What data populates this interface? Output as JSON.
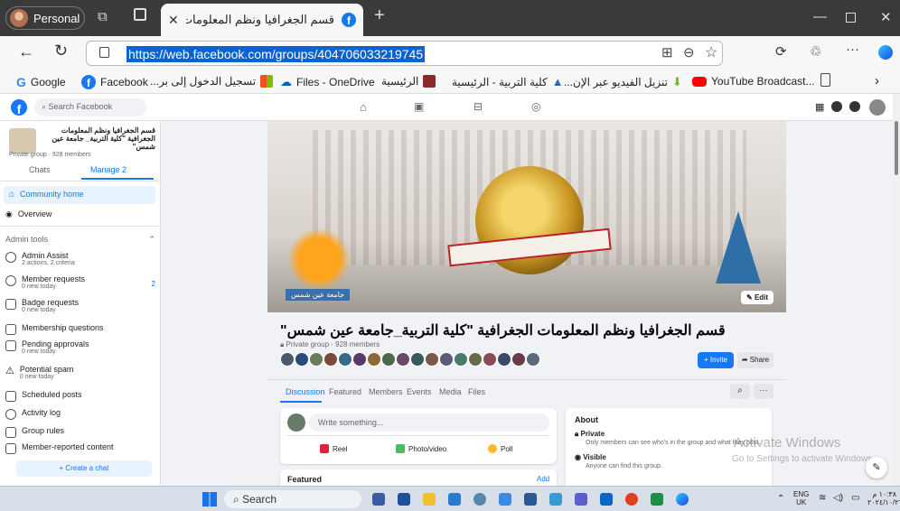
{
  "browser": {
    "profile_label": "Personal",
    "tab_title": "قسم الجغرافيا ونظم المعلومات الجغ",
    "new_tab": "+",
    "url": "https://web.facebook.com/groups/404706033219745"
  },
  "bookmarks": [
    {
      "label": "Google",
      "color": "#4285f4"
    },
    {
      "label": "Facebook",
      "color": "#1877f2"
    },
    {
      "label": "تسجيل الدخول إلى بر...",
      "color": "#f25022"
    },
    {
      "label": "Files - OneDrive",
      "color": "#0364b8"
    },
    {
      "label": "الرئيسية",
      "color": "#8b2a2a"
    },
    {
      "label": "كلية التربية - الرئيسية",
      "color": "#3366aa"
    },
    {
      "label": "تنزيل الفيديو عبر الإن...",
      "color": "#7cb342"
    },
    {
      "label": "YouTube Broadcast...",
      "color": "#ff0000"
    }
  ],
  "facebook": {
    "search_placeholder": "Search Facebook"
  },
  "sidebar": {
    "group_name": "قسم الجغرافيا ونظم المعلومات الجغرافية \"كلية التربية_ جامعة عين شمس\"",
    "group_meta": "Private group · 928 members",
    "tab_chats": "Chats",
    "tab_manage": "Manage 2",
    "community_home": "Community home",
    "overview": "Overview",
    "admin_tools": "Admin tools",
    "items": [
      {
        "label": "Admin Assist",
        "sub": "2 actions, 2 criteria",
        "badge": ""
      },
      {
        "label": "Member requests",
        "sub": "0 new today",
        "badge": "2"
      },
      {
        "label": "Badge requests",
        "sub": "0 new today",
        "badge": ""
      },
      {
        "label": "Membership questions",
        "sub": "",
        "badge": ""
      },
      {
        "label": "Pending approvals",
        "sub": "0 new today",
        "badge": ""
      },
      {
        "label": "Potential spam",
        "sub": "0 new today",
        "badge": ""
      },
      {
        "label": "Scheduled posts",
        "sub": "",
        "badge": ""
      },
      {
        "label": "Activity log",
        "sub": "",
        "badge": ""
      },
      {
        "label": "Group rules",
        "sub": "",
        "badge": ""
      },
      {
        "label": "Member-reported content",
        "sub": "",
        "badge": ""
      }
    ],
    "create_chat": "+ Create a chat"
  },
  "group": {
    "title": "قسم الجغرافيا ونظم المعلومات الجغرافية \"كلية التربية_جامعة عين شمس\"",
    "meta": "Private group · 928 members",
    "edit": "Edit",
    "invite": "+ Invite",
    "share": "Share",
    "cover_text": "جامعة عين شمس",
    "tabs": [
      "Discussion",
      "Featured",
      "Members",
      "Events",
      "Media",
      "Files"
    ],
    "write_placeholder": "Write something...",
    "actions": [
      "Reel",
      "Photo/video",
      "Poll"
    ],
    "featured": "Featured",
    "add": "Add",
    "about": {
      "title": "About",
      "private_title": "Private",
      "private_desc": "Only members can see who's in the group and what they post.",
      "visible_title": "Visible",
      "visible_desc": "Anyone can find this group."
    }
  },
  "watermark": {
    "line1": "Activate Windows",
    "line2": "Go to Settings to activate Windows."
  },
  "taskbar": {
    "search": "Search",
    "lang1": "ENG",
    "lang2": "UK",
    "time": "١٠:٣٨ م",
    "date": "٢٠٢٤/١٠/٢٦"
  }
}
